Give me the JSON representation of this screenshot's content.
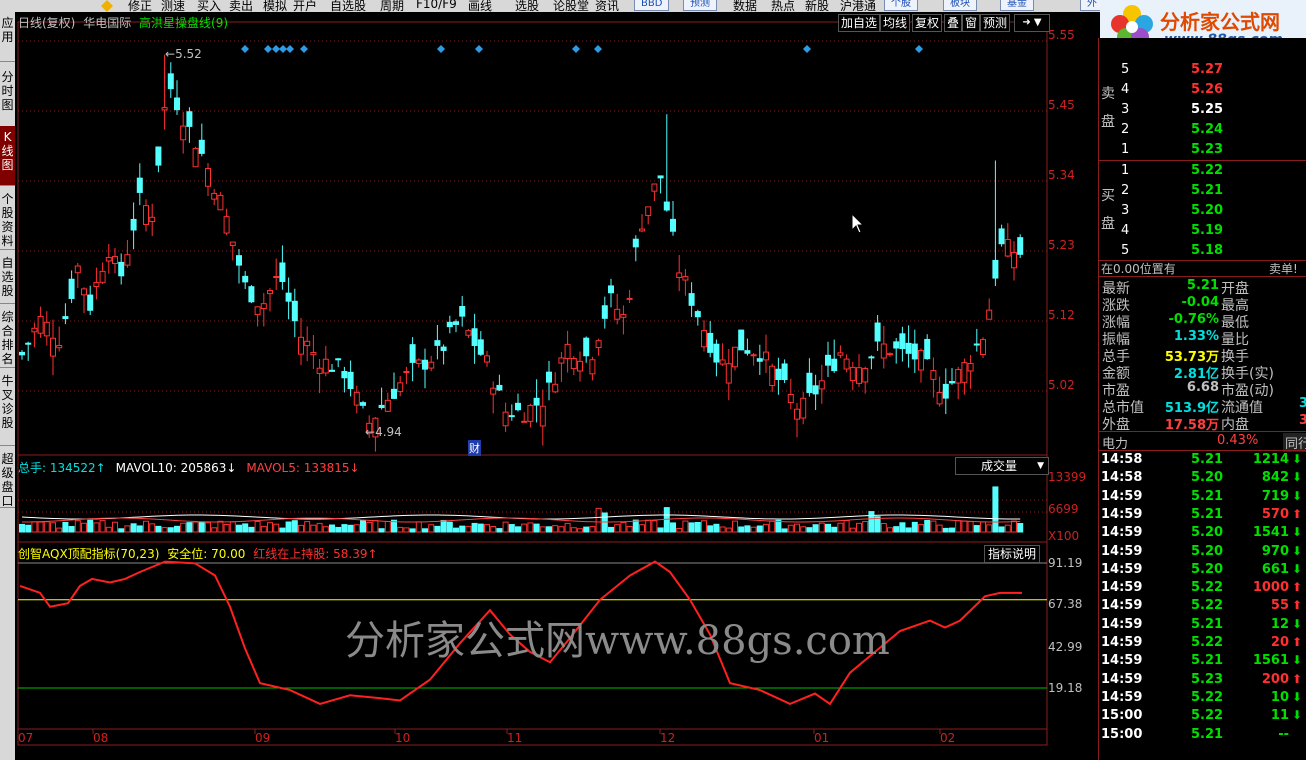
{
  "toolbar": {
    "items": [
      "修正",
      "测速",
      "买入",
      "卖出",
      "模拟",
      "开户",
      "自选股",
      "周期",
      "F10/F9",
      "画线",
      "选股",
      "论股堂",
      "资讯",
      "数据",
      "热点",
      "新股",
      "沪港通"
    ],
    "buttons": [
      "BBD",
      "预测",
      "个股",
      "板块",
      "基金",
      "外"
    ]
  },
  "logo": {
    "text": "分析家公式网",
    "url": "www.88gs.com"
  },
  "left_tabs": [
    "应用",
    "分时图",
    "K线图",
    "个股资料",
    "自选股",
    "综合排名",
    "牛叉诊股",
    "超级盘口"
  ],
  "chart": {
    "header": {
      "period": "日线(复权)",
      "stock": "华电国际",
      "indicator": "高洪星操盘线(9)"
    },
    "buttons": [
      "加自选",
      "均线",
      "复权",
      "叠",
      "窗",
      "预测"
    ],
    "price_axis": [
      "5.55",
      "5.45",
      "5.34",
      "5.23",
      "5.12",
      "5.02"
    ],
    "high_label": "5.52",
    "low_label": "4.94",
    "finance_marker": "财",
    "volume": {
      "label_total": "总手: 134522↑",
      "label_mavol10": "MAVOL10: 205863↓",
      "label_mavol5": "MAVOL5: 133815↓",
      "selector": "成交量",
      "axis": [
        "13399",
        "6699",
        "X100"
      ]
    },
    "indicator_panel": {
      "label_name": "创智AQX顶配指标(70,23)",
      "label_safe": "安全位: 70.00",
      "label_red": "红线在上持股: 58.39↑",
      "button": "指标说明",
      "axis": [
        "91.19",
        "67.38",
        "42.99",
        "19.18"
      ]
    },
    "x_axis": [
      "07",
      "08",
      "09",
      "10",
      "11",
      "12",
      "01",
      "02"
    ],
    "watermark": "分析家公式网www.88gs.com"
  },
  "chart_data": [
    {
      "type": "line",
      "title": "创智AQX顶配指标(70,23)",
      "x": [
        "07",
        "08",
        "09",
        "10",
        "11",
        "12",
        "01",
        "02"
      ],
      "series": [
        {
          "name": "红线",
          "values": [
            80,
            85,
            25,
            3,
            35,
            92,
            8,
            75
          ]
        }
      ],
      "ylim": [
        0,
        100
      ],
      "levels": {
        "安全位": 70.0
      }
    }
  ],
  "order_book": {
    "sell_label": "卖盘",
    "buy_label": "买盘",
    "sell": [
      {
        "n": "5",
        "p": "5.27"
      },
      {
        "n": "4",
        "p": "5.26"
      },
      {
        "n": "3",
        "p": "5.25"
      },
      {
        "n": "2",
        "p": "5.24"
      },
      {
        "n": "1",
        "p": "5.23"
      }
    ],
    "buy": [
      {
        "n": "1",
        "p": "5.22"
      },
      {
        "n": "2",
        "p": "5.21"
      },
      {
        "n": "3",
        "p": "5.20"
      },
      {
        "n": "4",
        "p": "5.19"
      },
      {
        "n": "5",
        "p": "5.18"
      }
    ],
    "status_left": "在0.00位置有",
    "status_right": "卖单!"
  },
  "quote": [
    {
      "k": "最新",
      "v": "5.21",
      "k2": "开盘",
      "c": "#00e000"
    },
    {
      "k": "涨跌",
      "v": "-0.04",
      "k2": "最高",
      "c": "#00e000"
    },
    {
      "k": "涨幅",
      "v": "-0.76%",
      "k2": "最低",
      "c": "#00e000"
    },
    {
      "k": "振幅",
      "v": "1.33%",
      "k2": "量比",
      "c": "#00e0e0"
    },
    {
      "k": "总手",
      "v": "53.73万",
      "k2": "换手",
      "c": "#ffff00"
    },
    {
      "k": "金额",
      "v": "2.81亿",
      "k2": "换手(实)",
      "c": "#00e0e0"
    },
    {
      "k": "市盈",
      "v": "6.68",
      "k2": "市盈(动)",
      "c": "#c0c0c0"
    },
    {
      "k": "总市值",
      "v": "513.9亿",
      "k2": "流通值",
      "c": "#00e0e0"
    },
    {
      "k": "外盘",
      "v": "17.58万",
      "k2": "内盘",
      "c": "#ff4040"
    }
  ],
  "quote_extra": {
    "flow_cap_1": "3",
    "flow_cap_2": "3"
  },
  "power": {
    "label": "电力",
    "value": "0.43%",
    "right": "同行"
  },
  "ticks": [
    {
      "t": "14:58",
      "p": "5.21",
      "v": "1214",
      "d": "down"
    },
    {
      "t": "14:58",
      "p": "5.20",
      "v": "842",
      "d": "down"
    },
    {
      "t": "14:59",
      "p": "5.21",
      "v": "719",
      "d": "down"
    },
    {
      "t": "14:59",
      "p": "5.21",
      "v": "570",
      "d": "up"
    },
    {
      "t": "14:59",
      "p": "5.20",
      "v": "1541",
      "d": "down"
    },
    {
      "t": "14:59",
      "p": "5.20",
      "v": "970",
      "d": "down"
    },
    {
      "t": "14:59",
      "p": "5.20",
      "v": "661",
      "d": "down"
    },
    {
      "t": "14:59",
      "p": "5.22",
      "v": "1000",
      "d": "up"
    },
    {
      "t": "14:59",
      "p": "5.22",
      "v": "55",
      "d": "up"
    },
    {
      "t": "14:59",
      "p": "5.21",
      "v": "12",
      "d": "down"
    },
    {
      "t": "14:59",
      "p": "5.22",
      "v": "20",
      "d": "up"
    },
    {
      "t": "14:59",
      "p": "5.21",
      "v": "1561",
      "d": "down"
    },
    {
      "t": "14:59",
      "p": "5.23",
      "v": "200",
      "d": "up"
    },
    {
      "t": "14:59",
      "p": "5.22",
      "v": "10",
      "d": "down"
    },
    {
      "t": "15:00",
      "p": "5.22",
      "v": "11",
      "d": "down"
    },
    {
      "t": "15:00",
      "p": "5.21",
      "v": "--",
      "d": "none"
    }
  ]
}
